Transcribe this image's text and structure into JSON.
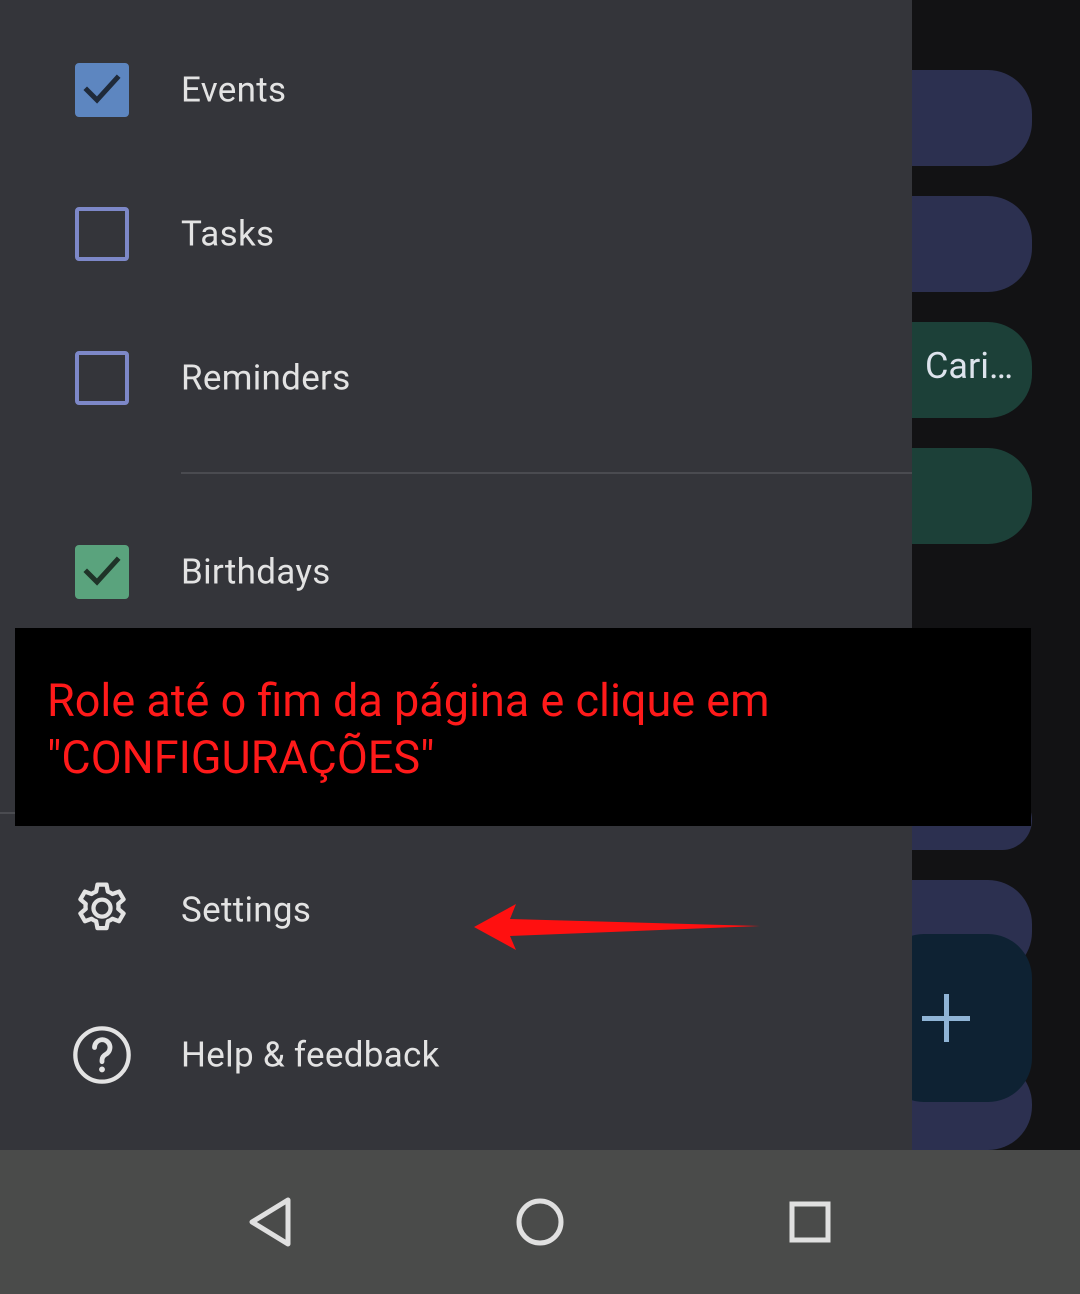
{
  "background": {
    "event_chip_text": "Cari…"
  },
  "drawer": {
    "items": [
      {
        "label": "Events",
        "checked": true,
        "color": "#5d86c0"
      },
      {
        "label": "Tasks",
        "checked": false,
        "color": "#7d88c8"
      },
      {
        "label": "Reminders",
        "checked": false,
        "color": "#7d88c8"
      },
      {
        "label": "Birthdays",
        "checked": true,
        "color": "#5aa37d"
      }
    ],
    "settings_label": "Settings",
    "help_label": "Help & feedback"
  },
  "annotation": {
    "line1": "Role até o fim da página e clique em",
    "line2": "\"CONFIGURAÇÕES\"",
    "color": "#ff1a1a"
  },
  "navbar": {
    "buttons": [
      "back-icon",
      "home-icon",
      "recents-icon"
    ]
  },
  "colors": {
    "drawer_bg": "#34353a",
    "navbar_bg": "#4a4b4a",
    "text": "#e3e3e3"
  }
}
